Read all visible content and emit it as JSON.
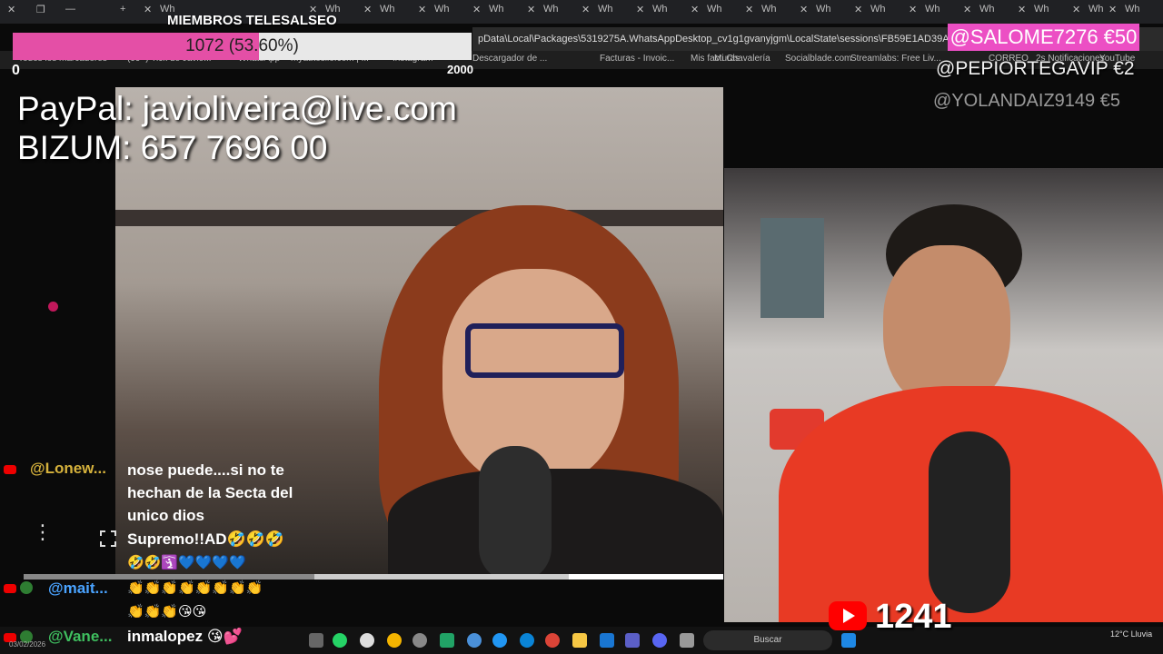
{
  "browser": {
    "tabs": [
      {
        "close": "✕",
        "label": "Wh"
      },
      {
        "close": "✕",
        "label": "Wh"
      },
      {
        "close": "✕",
        "label": "Wh"
      },
      {
        "close": "✕",
        "label": "Wh"
      },
      {
        "close": "✕",
        "label": "Wh"
      },
      {
        "close": "✕",
        "label": "Wh"
      },
      {
        "close": "✕",
        "label": "Wh"
      },
      {
        "close": "✕",
        "label": "Wh"
      },
      {
        "close": "✕",
        "label": "Wh"
      },
      {
        "close": "✕",
        "label": "Wh"
      },
      {
        "close": "✕",
        "label": "Wh"
      },
      {
        "close": "✕",
        "label": "Wh"
      },
      {
        "close": "✕",
        "label": "Wh"
      },
      {
        "close": "✕",
        "label": "Wh"
      },
      {
        "close": "✕",
        "label": "Wh"
      },
      {
        "close": "✕",
        "label": "Wh"
      },
      {
        "close": "✕",
        "label": "Wh"
      },
      {
        "close": "✕",
        "label": "Wh"
      }
    ],
    "address": "pData\\Local\\Packages\\5319275A.WhatsAppDesktop_cv1g1gvanyjgm\\LocalState\\sessions\\FB59E1AD39A84EF63BEDE22BD23 1CF",
    "bookmarks": [
      "Todos los marcadores",
      "(99+) Tick de Javie...",
      "WhatsApp",
      "myautosilo.com | ...",
      "Instagram",
      "Descargador de ...",
      "Facturas - Invoic...",
      "Mis facturas",
      "Mi Chavalería",
      "Socialblade.com",
      "Streamlabs: Free Liv...",
      "CORREO",
      "2s Notificaciones",
      "YouTube"
    ]
  },
  "goal": {
    "title": "MIEMBROS TELESALSEO",
    "progress_text": "1072 (53.60%)",
    "progress_fraction": 0.536,
    "min": "0",
    "max": "2000"
  },
  "donations": [
    {
      "text": "@SALOME7276  €50"
    },
    {
      "text": "@PEPIORTEGAVIP  €2"
    },
    {
      "text": "@YOLANDAIZ9149  €5"
    }
  ],
  "payment": {
    "paypal": "PayPal: javioliveira@live.com",
    "bizum": "BIZUM: 657 7696 00"
  },
  "viewers": {
    "count": "1241"
  },
  "chat": [
    {
      "user": "@Lonew...",
      "lines": [
        "nose puede....si no te",
        "hechan de la Secta del",
        "unico dios",
        "Supremo!!AD🤣🤣🤣",
        "🤣🤣🛐💙💙💙💙"
      ]
    },
    {
      "user": "@mait...",
      "lines": [
        "👏👏👏👏👏👏👏👏",
        "👏👏👏😘😘"
      ]
    },
    {
      "user": "@Vane...",
      "lines": [
        "inmalopez 😘💕"
      ]
    }
  ],
  "taskbar": {
    "search_placeholder": "Buscar",
    "weather": "12°C Lluvia",
    "date": "03/02/2026"
  },
  "colors": {
    "goal_fill": "#e44fa6",
    "donation_highlight": "#ec4fc4",
    "youtube_red": "#ff0000"
  }
}
